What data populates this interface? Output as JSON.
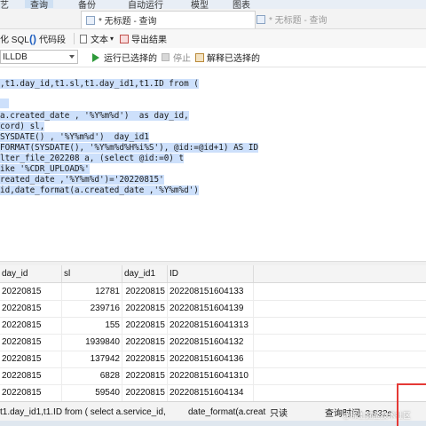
{
  "menu": {
    "items": [
      "艺",
      "查询",
      "备份",
      "自动运行",
      "模型",
      "图表"
    ],
    "active_index": 1
  },
  "tabs": [
    {
      "label": "* 无标题 - 查询",
      "active": true
    },
    {
      "label": "* 无标题 - 查询",
      "active": false
    }
  ],
  "toolbar1": {
    "beautify_label": "化 SQL",
    "snippet_label": "代码段",
    "text_label": "文本",
    "export_label": "导出结果"
  },
  "toolbar2": {
    "db_value": "ILLDB",
    "run_label": "运行已选择的",
    "stop_label": "停止",
    "explain_label": "解释已选择的"
  },
  "editor": {
    "lines": [
      ",t1.day_id,t1.sl,t1.day_id1,t1.ID from (",
      "",
      "a.created_date , '%Y%m%d')  as day_id,",
      "cord) sl,",
      "SYSDATE() , '%Y%m%d')  day_id1",
      "FORMAT(SYSDATE(), '%Y%m%d%H%i%S'), @id:=@id+1) AS ID",
      "lter_file_202208 a, (select @id:=0) t",
      "ike '%CDR_UPLOAD%'",
      "reated_date ,'%Y%m%d')='20220815'",
      "id,date_format(a.created_date ,'%Y%m%d')"
    ]
  },
  "grid": {
    "columns": [
      "day_id",
      "sl",
      "day_id1",
      "ID"
    ],
    "rows": [
      [
        "20220815",
        "12781",
        "20220815",
        "202208151604133"
      ],
      [
        "20220815",
        "239716",
        "20220815",
        "202208151604139"
      ],
      [
        "20220815",
        "155",
        "20220815",
        "2022081516041313"
      ],
      [
        "20220815",
        "1939840",
        "20220815",
        "202208151604132"
      ],
      [
        "20220815",
        "137942",
        "20220815",
        "202208151604136"
      ],
      [
        "20220815",
        "6828",
        "20220815",
        "2022081516041310"
      ],
      [
        "20220815",
        "59540",
        "20220815",
        "202208151604134"
      ]
    ]
  },
  "status": {
    "sql_text": "t1.day_id1,t1.ID from (  select a.service_id,",
    "sql_text2": "date_format(a.creat",
    "mode": "只读",
    "query_time": "查询时间: 3.832s"
  },
  "watermark": "@稀土掘金技术社区",
  "colors": {
    "selection": "#cde0fb",
    "keyword": "#1f3fcf",
    "string": "#a020a0",
    "number": "#1f7a1f",
    "highlight_box": "#e53935",
    "run_icon": "#2e9a3a"
  }
}
